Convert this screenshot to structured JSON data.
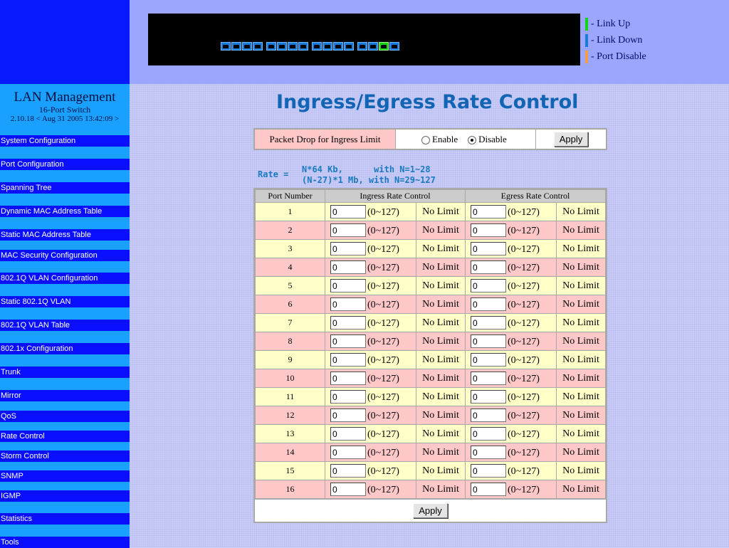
{
  "brand": {
    "title": "LAN Management",
    "subtitle": "16-Port Switch",
    "version": "2.10.18 < Aug 31 2005 13:42:09 >"
  },
  "nav": [
    "System Configuration",
    "Port Configuration",
    "Spanning Tree",
    "Dynamic MAC Address Table",
    "Static MAC Address Table",
    "MAC Security Configuration",
    "802.1Q VLAN Configuration",
    "Static 802.1Q VLAN",
    "802.1Q VLAN Table",
    "802.1x Configuration",
    "Trunk",
    "Mirror",
    "QoS",
    "Rate Control",
    "Storm Control",
    "SNMP",
    "IGMP",
    "Statistics",
    "Tools"
  ],
  "legend": {
    "link_up": "- Link Up",
    "link_down": "- Link Down",
    "port_disable": "- Port Disable",
    "colors": {
      "link_up": "#14d214",
      "link_down": "#1a7ad8",
      "port_disable": "#f0a040"
    }
  },
  "ports_status": [
    "down",
    "down",
    "down",
    "down",
    "down",
    "down",
    "down",
    "down",
    "down",
    "down",
    "down",
    "down",
    "down",
    "down",
    "up",
    "down"
  ],
  "page": {
    "title": "Ingress/Egress Rate Control",
    "drop_label": "Packet Drop for Ingress Limit",
    "enable_label": "Enable",
    "disable_label": "Disable",
    "selected": "Disable",
    "apply_label": "Apply",
    "rate_label": "Rate =",
    "rate_line1": "N*64 Kb,      with N=1~28",
    "rate_line2": "(N-27)*1 Mb, with N=29~127"
  },
  "table": {
    "headers": {
      "port": "Port Number",
      "ingress": "Ingress Rate Control",
      "egress": "Egress Rate Control"
    },
    "range_text": "(0~127)",
    "no_limit_text": "No Limit",
    "rows": [
      {
        "port": "1",
        "ingress": "0",
        "egress": "0"
      },
      {
        "port": "2",
        "ingress": "0",
        "egress": "0"
      },
      {
        "port": "3",
        "ingress": "0",
        "egress": "0"
      },
      {
        "port": "4",
        "ingress": "0",
        "egress": "0"
      },
      {
        "port": "5",
        "ingress": "0",
        "egress": "0"
      },
      {
        "port": "6",
        "ingress": "0",
        "egress": "0"
      },
      {
        "port": "7",
        "ingress": "0",
        "egress": "0"
      },
      {
        "port": "8",
        "ingress": "0",
        "egress": "0"
      },
      {
        "port": "9",
        "ingress": "0",
        "egress": "0"
      },
      {
        "port": "10",
        "ingress": "0",
        "egress": "0"
      },
      {
        "port": "11",
        "ingress": "0",
        "egress": "0"
      },
      {
        "port": "12",
        "ingress": "0",
        "egress": "0"
      },
      {
        "port": "13",
        "ingress": "0",
        "egress": "0"
      },
      {
        "port": "14",
        "ingress": "0",
        "egress": "0"
      },
      {
        "port": "15",
        "ingress": "0",
        "egress": "0"
      },
      {
        "port": "16",
        "ingress": "0",
        "egress": "0"
      }
    ]
  }
}
